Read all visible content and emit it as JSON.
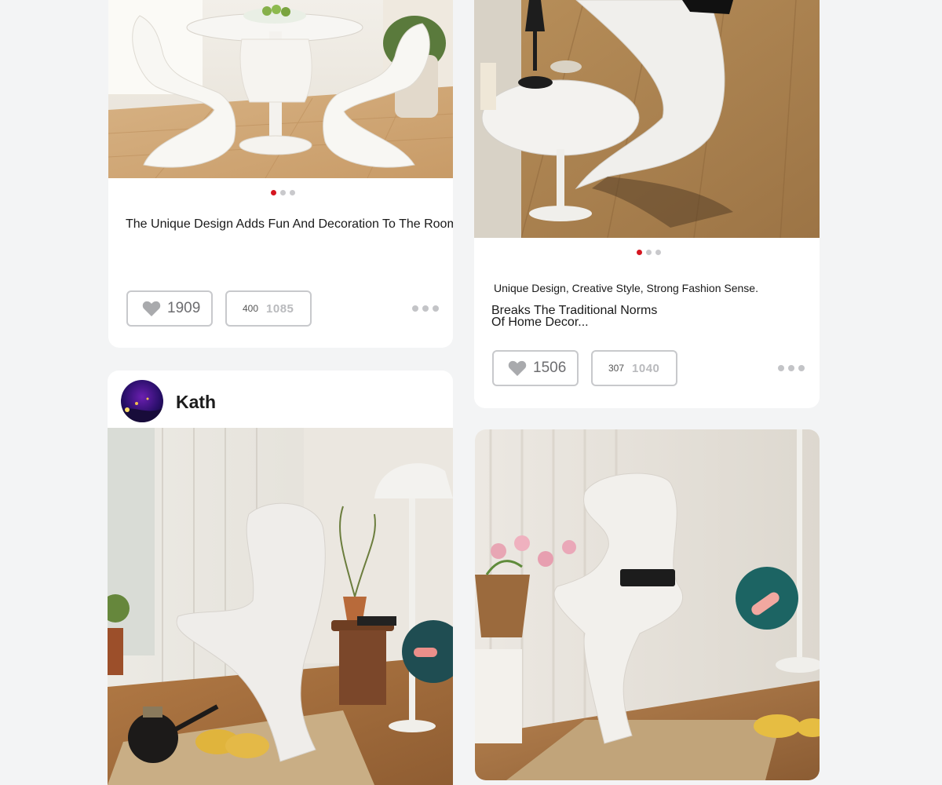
{
  "posts": [
    {
      "title": "The Unique Design Adds Fun And Decoration To The Room.",
      "carousel": {
        "total": 3,
        "active": 1
      },
      "like_count": "1909",
      "comment_count": "400",
      "comment_count_faint": "1085"
    },
    {
      "subtitle": "Unique Design, Creative Style, Strong Fashion Sense.",
      "title_line1": "Breaks The Traditional Norms",
      "title_line2": "Of Home Decor...",
      "carousel": {
        "total": 3,
        "active": 1
      },
      "like_count": "1506",
      "comment_count": "307",
      "comment_count_faint": "1040"
    },
    {
      "author": "Kath"
    },
    {}
  ],
  "icons": {
    "like": "heart-icon",
    "more": "more-dots-icon"
  },
  "colors": {
    "accent": "#d51620",
    "background": "#f3f4f5",
    "card": "#ffffff"
  }
}
